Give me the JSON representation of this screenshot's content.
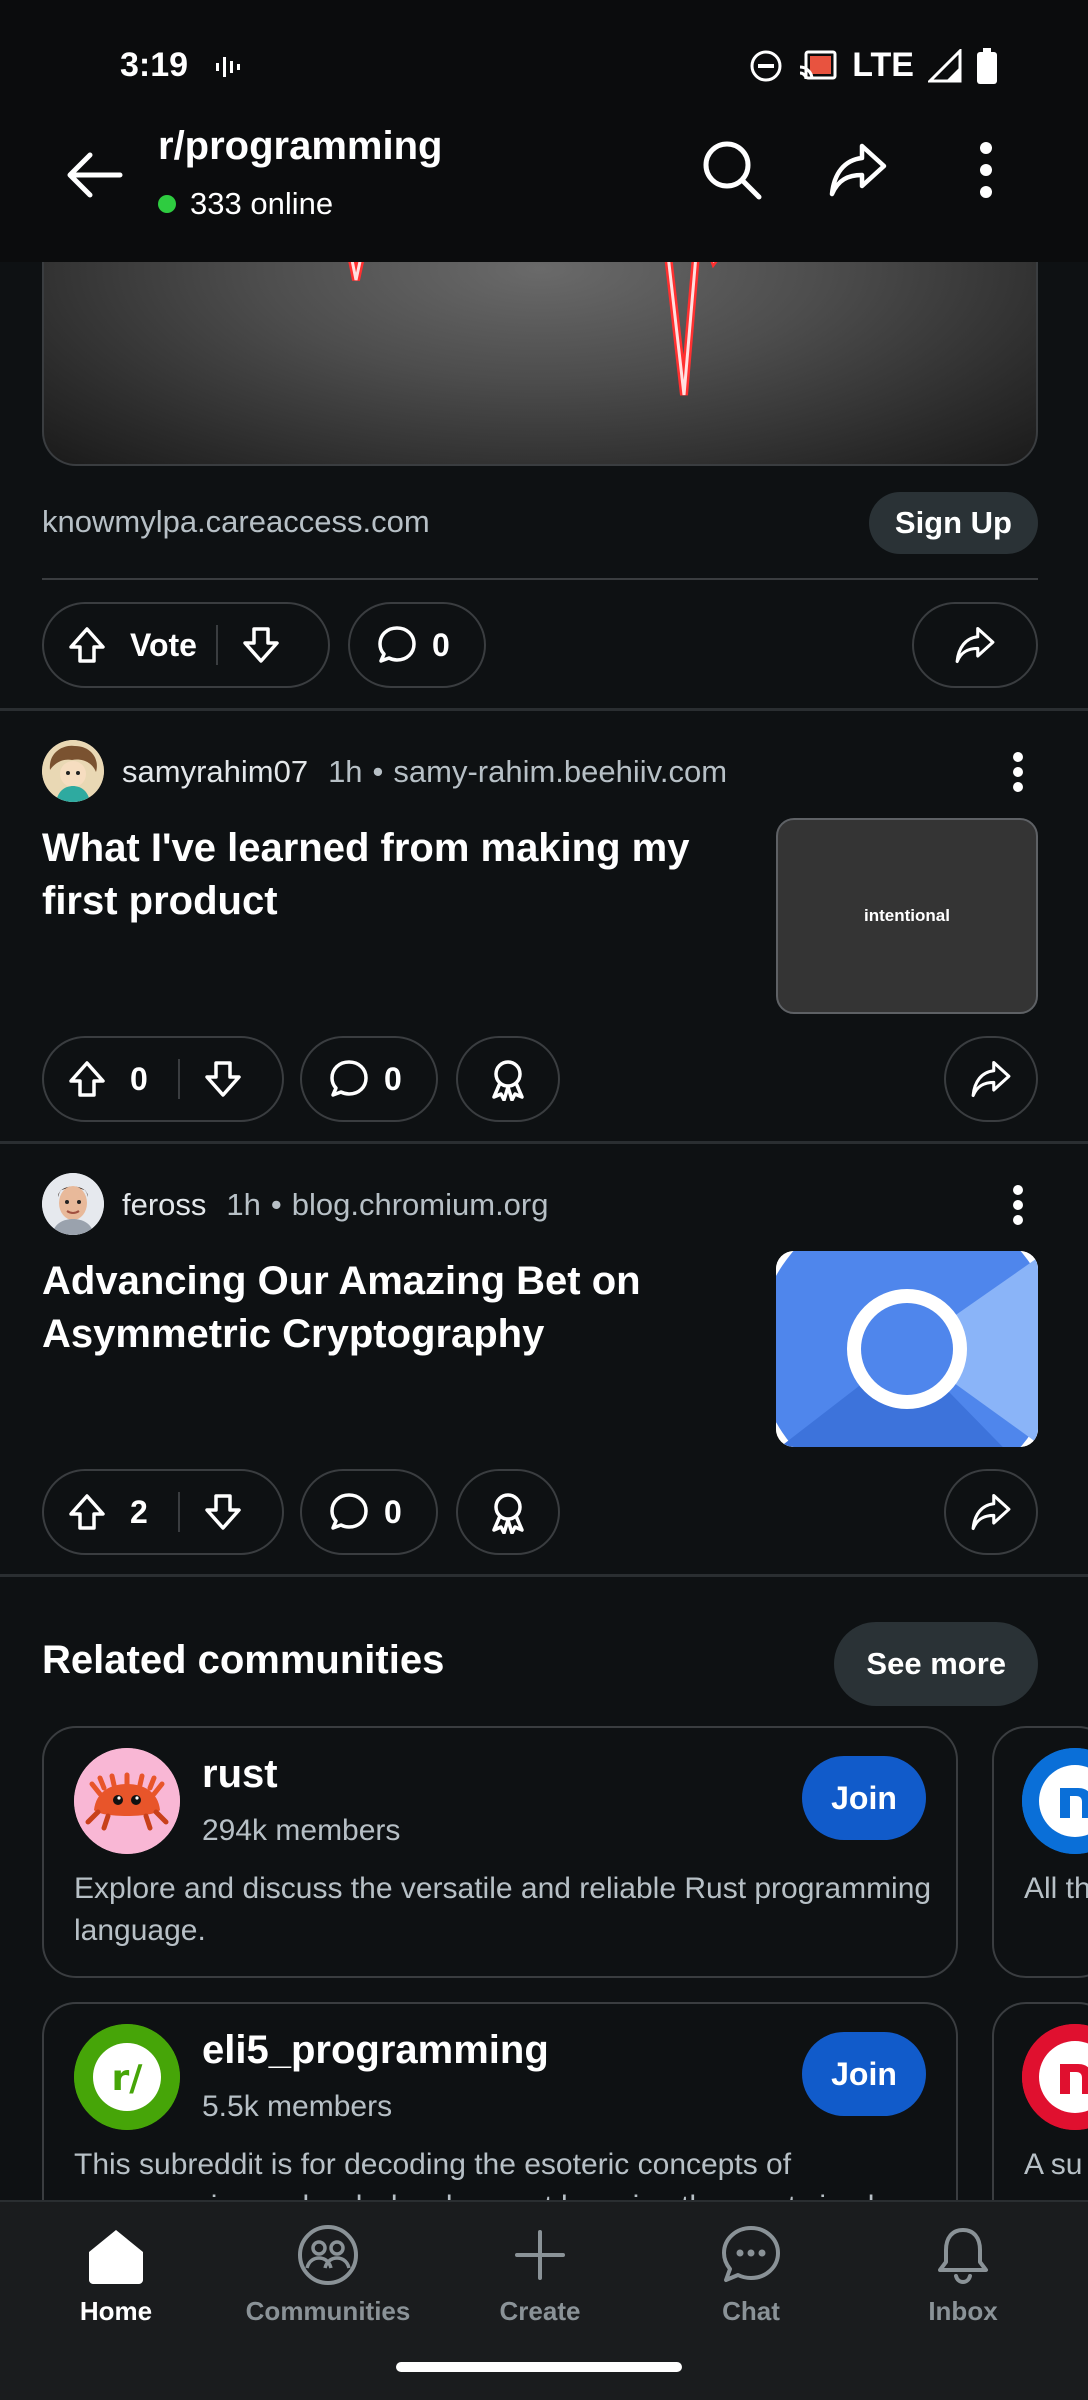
{
  "status_bar": {
    "time": "3:19",
    "network": "LTE"
  },
  "header": {
    "subreddit": "r/programming",
    "online_count": "333 online"
  },
  "ad": {
    "domain": "knowmylpa.careaccess.com",
    "cta_label": "Sign Up",
    "vote_label": "Vote",
    "comment_count": "0"
  },
  "posts": [
    {
      "author": "samyrahim07",
      "age": "1h",
      "separator": "•",
      "domain": "samy-rahim.beehiiv.com",
      "title": "What I've learned from making my first product",
      "thumbnail_text": "intentional",
      "score": "0",
      "comments": "0"
    },
    {
      "author": "feross",
      "age": "1h",
      "separator": "•",
      "domain": "blog.chromium.org",
      "title": "Advancing Our Amazing Bet on Asymmetric Cryptography",
      "score": "2",
      "comments": "0"
    }
  ],
  "related": {
    "title": "Related communities",
    "see_more_label": "See more",
    "communities": [
      {
        "name": "rust",
        "members": "294k members",
        "description": "Explore and discuss the versatile and reliable Rust programming language.",
        "join_label": "Join"
      },
      {
        "name": "eli5_programming",
        "members": "5.5k members",
        "description": "This subreddit is for decoding the esoteric concepts of programming and web development by using the most simpl",
        "join_label": "Join",
        "avatar_text": "r/"
      }
    ],
    "peek": [
      {
        "text": "All th"
      },
      {
        "text": "A su"
      }
    ]
  },
  "bottom_nav": {
    "items": [
      {
        "label": "Home",
        "icon": "home-icon",
        "active": true
      },
      {
        "label": "Communities",
        "icon": "communities-icon"
      },
      {
        "label": "Create",
        "icon": "plus-icon"
      },
      {
        "label": "Chat",
        "icon": "chat-icon"
      },
      {
        "label": "Inbox",
        "icon": "bell-icon"
      }
    ]
  },
  "colors": {
    "background": "#0e1113",
    "join_blue": "#115bca",
    "online_green": "#2ecc40"
  }
}
